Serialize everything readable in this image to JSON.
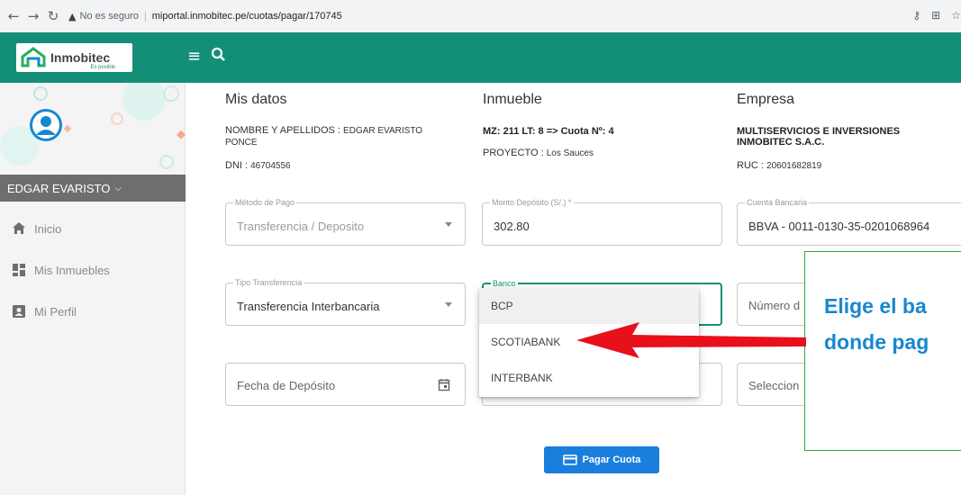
{
  "browser": {
    "back_icon": "arrow-left-icon",
    "forward_icon": "arrow-right-icon",
    "reload_icon": "reload-icon",
    "security_label": "No es seguro",
    "url": "miportal.inmobitec.pe/cuotas/pagar/170745"
  },
  "header": {
    "logo_name": "Inmobitec",
    "logo_tagline": "Es posible",
    "color": "#148f77"
  },
  "sidebar": {
    "user_name": "EDGAR EVARISTO",
    "items": [
      {
        "label": "Inicio",
        "icon": "home-icon"
      },
      {
        "label": "Mis Inmuebles",
        "icon": "grid-icon"
      },
      {
        "label": "Mi Perfil",
        "icon": "profile-icon"
      }
    ]
  },
  "mis_datos": {
    "title": "Mis datos",
    "name_label": "NOMBRE Y APELLIDOS :",
    "name_value_line1": "EDGAR EVARISTO",
    "name_value_line2": "PONCE",
    "dni_label": "DNI :",
    "dni_value": "46704556"
  },
  "inmueble": {
    "title": "Inmueble",
    "lote": "MZ: 211 LT: 8 => Cuota Nº: 4",
    "proyecto_label": "PROYECTO :",
    "proyecto_value": "Los Sauces"
  },
  "empresa": {
    "title": "Empresa",
    "name_line1": "MULTISERVICIOS E INVERSIONES",
    "name_line2": "INMOBITEC S.A.C.",
    "ruc_label": "RUC :",
    "ruc_value": "20601682819"
  },
  "form": {
    "metodo_label": "Método de Pago",
    "metodo_value": "Transferencia / Deposito",
    "monto_label": "Monto Depósito (S/.) *",
    "monto_value": "302.80",
    "cuenta_label": "Cuenta Bancaria",
    "cuenta_value": "BBVA - 0011-0130-35-0201068964",
    "tipo_label": "Tipo Transferencia",
    "tipo_value": "Transferencia Interbancaria",
    "banco_label": "Banco",
    "numero_placeholder": "Número d",
    "fecha_placeholder": "Fecha de Depósito",
    "seleccion_placeholder": "Seleccion"
  },
  "banco_options": [
    "BCP",
    "SCOTIABANK",
    "INTERBANK"
  ],
  "pay_button": "Pagar Cuota",
  "annotation": {
    "line1": "Elige el ba",
    "line2": "donde pag",
    "text_color": "#1787cf",
    "arrow_color": "#e8101a"
  }
}
